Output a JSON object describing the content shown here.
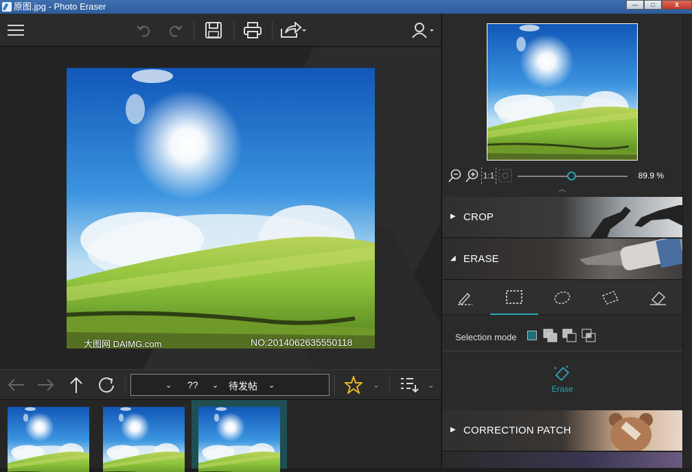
{
  "window": {
    "title": "原图.jpg - Photo Eraser",
    "minimize": "—",
    "maximize": "□",
    "close": "X"
  },
  "toolbar": {
    "menu": "menu-icon",
    "undo": "undo-icon",
    "redo": "redo-icon",
    "save": "save-icon",
    "print": "print-icon",
    "share": "share-icon",
    "user": "user-icon"
  },
  "photo": {
    "watermark_left": "大图网 DAIMG.com",
    "watermark_right": "NO:20140626355501​18"
  },
  "navbar": {
    "combo_mid": "??",
    "combo_right": "待发帖"
  },
  "zoom": {
    "value_text": "89.9 %",
    "level_fraction": 0.48,
    "actual_size": "1:1"
  },
  "panels": {
    "crop": "CROP",
    "erase": "ERASE",
    "correction": "CORRECTION PATCH"
  },
  "erase": {
    "selection_mode_label": "Selection mode",
    "action_label": "Erase",
    "tools": [
      "brush-tool-icon",
      "rect-select-icon",
      "ellipse-select-icon",
      "polygon-select-icon",
      "eraser-tool-icon"
    ]
  },
  "colors": {
    "accent": "#29a6b4",
    "titlebar": "#2e5c9c",
    "star": "#e9b524"
  }
}
